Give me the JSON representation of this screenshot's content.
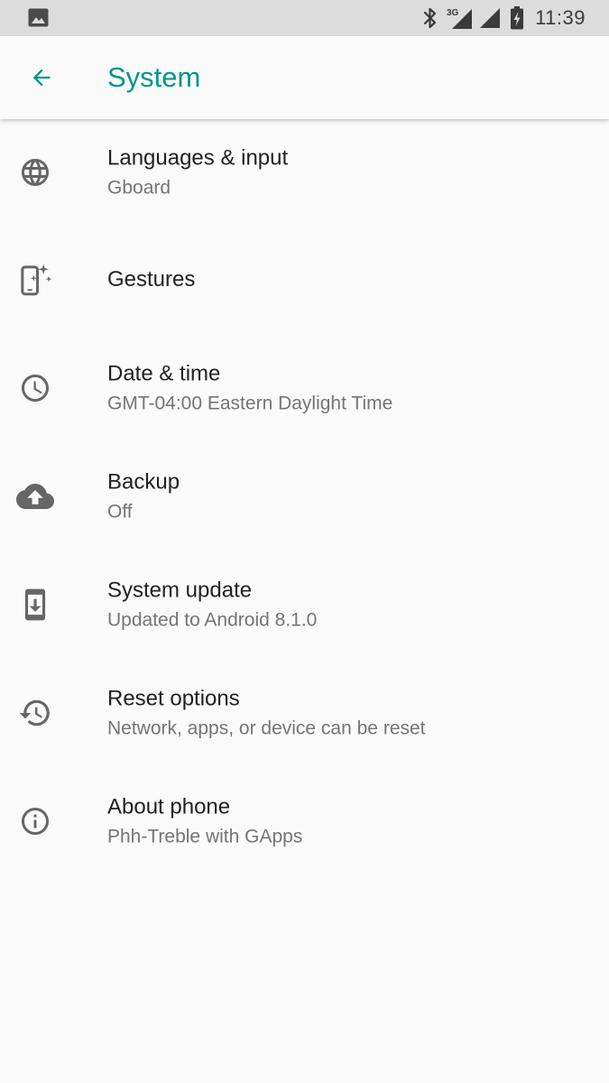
{
  "status_bar": {
    "network_label": "3G",
    "time": "11:39",
    "icons": [
      "image-notification-icon",
      "bluetooth-icon",
      "cellular-signal-icon",
      "wifi-signal-icon",
      "battery-charging-icon"
    ]
  },
  "app_bar": {
    "title": "System",
    "back_icon": "arrow-back-icon",
    "accent_color": "#009688"
  },
  "items": [
    {
      "title": "Languages & input",
      "summary": "Gboard",
      "icon": "globe-icon"
    },
    {
      "title": "Gestures",
      "summary": "",
      "icon": "gestures-icon"
    },
    {
      "title": "Date & time",
      "summary": "GMT-04:00 Eastern Daylight Time",
      "icon": "clock-icon"
    },
    {
      "title": "Backup",
      "summary": "Off",
      "icon": "cloud-upload-icon"
    },
    {
      "title": "System update",
      "summary": "Updated to Android 8.1.0",
      "icon": "system-update-icon"
    },
    {
      "title": "Reset options",
      "summary": "Network, apps, or device can be reset",
      "icon": "restore-icon"
    },
    {
      "title": "About phone",
      "summary": "Phh-Treble with GApps",
      "icon": "info-icon"
    }
  ]
}
